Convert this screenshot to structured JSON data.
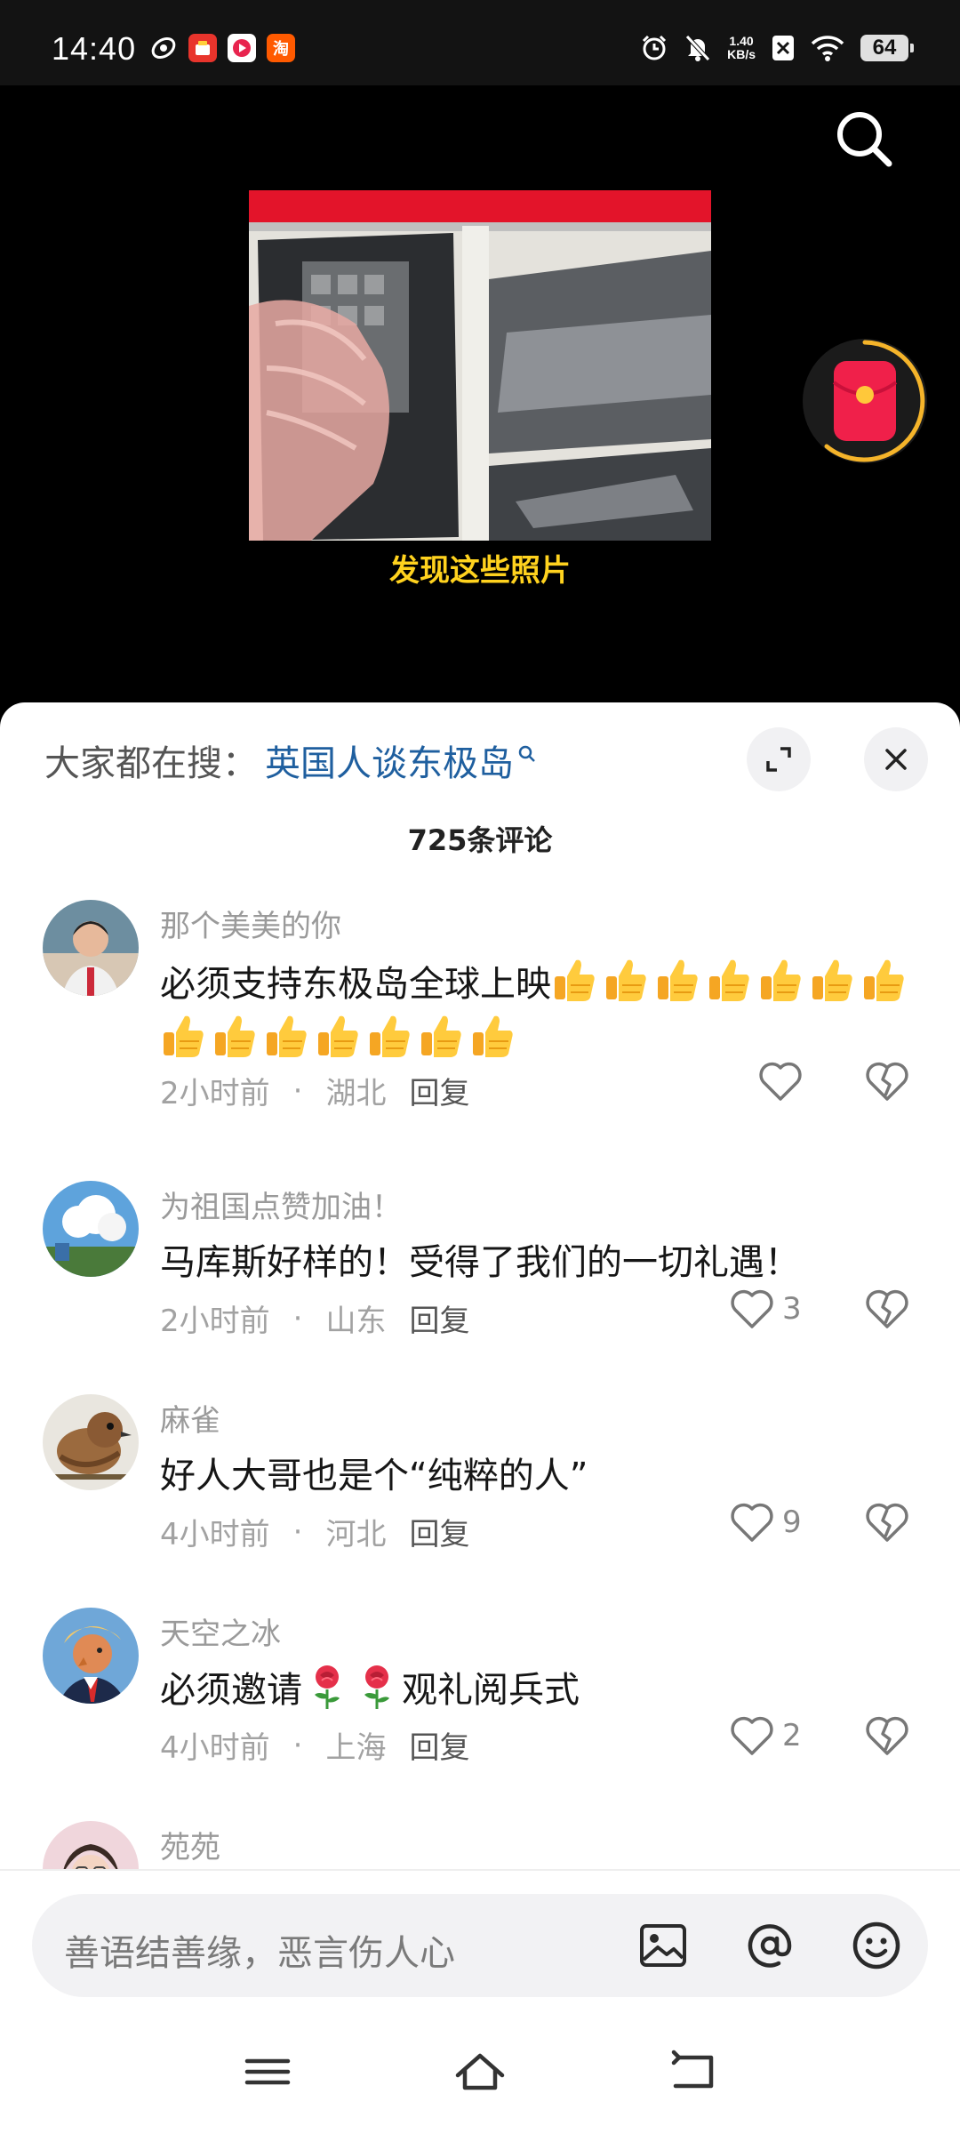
{
  "status_bar": {
    "time": "14:40",
    "app_icons": [
      "app-a-icon",
      "app-b-icon",
      "app-c-icon",
      "taobao-icon"
    ],
    "taobao_glyph": "淘",
    "net_speed_value": "1.40",
    "net_speed_unit": "KB/s",
    "battery": "64"
  },
  "video": {
    "subtitle": "发现这些照片"
  },
  "comment_sheet": {
    "hot_search_label": "大家都在搜：",
    "hot_search_term": "英国人谈东极岛",
    "comment_count": "725条评论",
    "comments": [
      {
        "name": "那个美美的你",
        "text": "必须支持东极岛全球上映",
        "thumbs_count": 14,
        "time": "2小时前",
        "location": "湖北",
        "reply": "回复",
        "likes": ""
      },
      {
        "name": "为祖国点赞加油！",
        "text": "马库斯好样的！受得了我们的一切礼遇！",
        "time": "2小时前",
        "location": "山东",
        "reply": "回复",
        "likes": "3"
      },
      {
        "name": "麻雀",
        "text": "好人大哥也是个“纯粹的人”",
        "time": "4小时前",
        "location": "河北",
        "reply": "回复",
        "likes": "9"
      },
      {
        "name": "天空之冰",
        "text_before": "必须邀请",
        "text_after": "观礼阅兵式",
        "time": "4小时前",
        "location": "上海",
        "reply": "回复",
        "likes": "2"
      },
      {
        "name": "苑苑"
      }
    ]
  },
  "input": {
    "placeholder": "善语结善缘，恶言伤人心"
  },
  "colors": {
    "link": "#1f5f9f",
    "subtitle": "#ffd21e",
    "redpacket": "#f0204a",
    "ring": "#f5b42a"
  }
}
